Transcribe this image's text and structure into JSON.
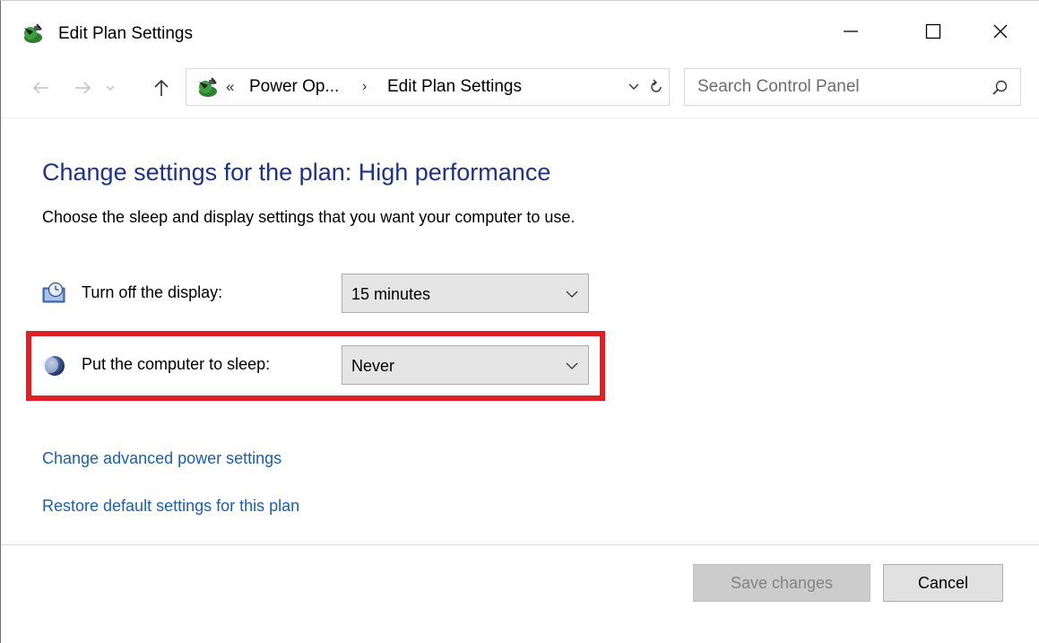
{
  "window": {
    "title": "Edit Plan Settings"
  },
  "address_bar": {
    "overflow_chevron": "«",
    "crumbs": [
      "Power Op...",
      "Edit Plan Settings"
    ],
    "separator": "›"
  },
  "search": {
    "placeholder": "Search Control Panel",
    "value": ""
  },
  "content": {
    "heading": "Change settings for the plan: High performance",
    "subheading": "Choose the sleep and display settings that you want your computer to use.",
    "settings": [
      {
        "label": "Turn off the display:",
        "value": "15 minutes",
        "icon": "display-timer-icon"
      },
      {
        "label": "Put the computer to sleep:",
        "value": "Never",
        "icon": "sleep-moon-icon"
      }
    ],
    "links": [
      "Change advanced power settings",
      "Restore default settings for this plan"
    ]
  },
  "buttons": {
    "save": "Save changes",
    "cancel": "Cancel"
  },
  "colors": {
    "heading": "#1e3287",
    "link": "#1a5fae",
    "highlight": "#e01f26"
  }
}
